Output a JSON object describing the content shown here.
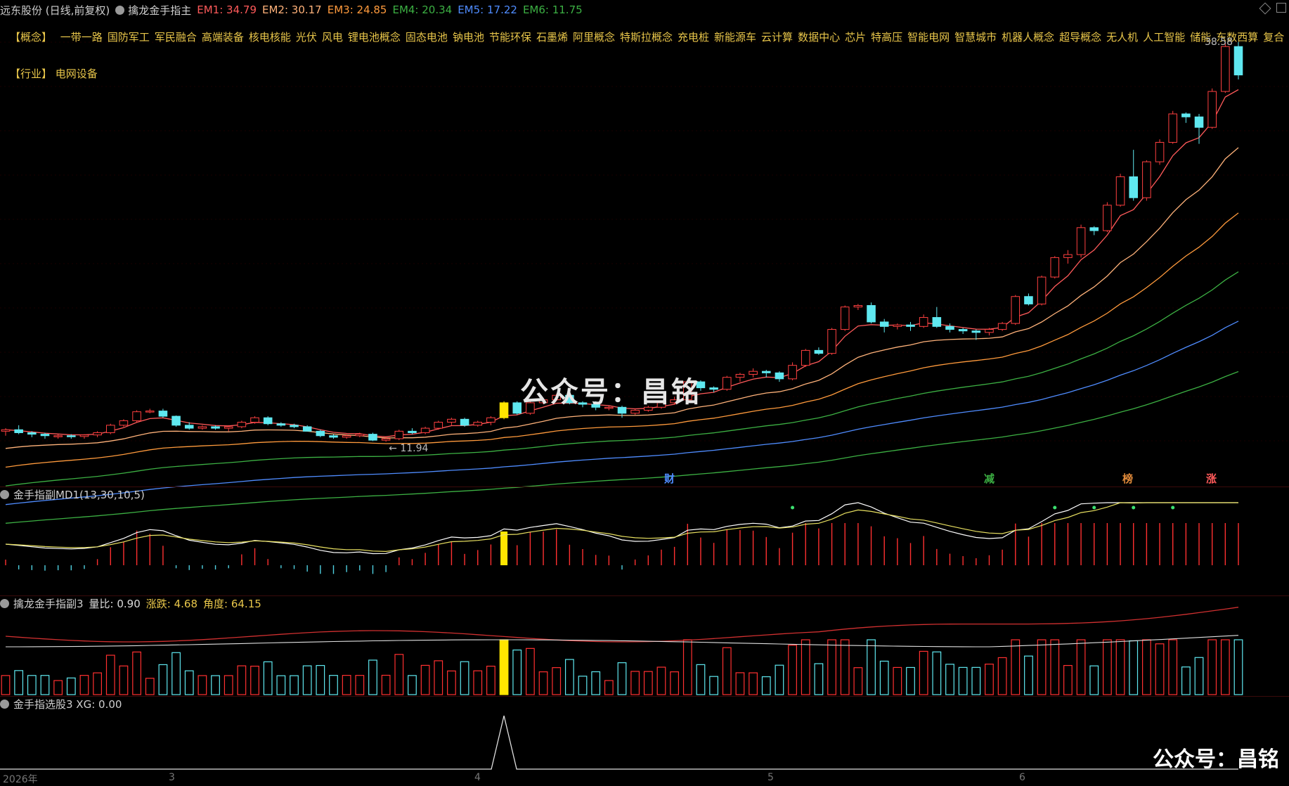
{
  "header": {
    "stock": "远东股份 (日线,前复权)",
    "indicator": "擒龙金手指主",
    "em": [
      {
        "label": "EM1: 34.79",
        "color": "#ff5a5a"
      },
      {
        "label": "EM2: 30.17",
        "color": "#ffb27a"
      },
      {
        "label": "EM3: 24.85",
        "color": "#ff9a3c"
      },
      {
        "label": "EM4: 20.34",
        "color": "#3cb043"
      },
      {
        "label": "EM5: 17.22",
        "color": "#4f8cff"
      },
      {
        "label": "EM6: 11.75",
        "color": "#3cb043"
      }
    ]
  },
  "concepts": {
    "label": "【概念】",
    "items": [
      "一带一路",
      "国防军工",
      "军民融合",
      "高端装备",
      "核电核能",
      "光伏",
      "风电",
      "锂电池概念",
      "固态电池",
      "钠电池",
      "节能环保",
      "石墨烯",
      "阿里概念",
      "特斯拉概念",
      "充电桩",
      "新能源车",
      "云计算",
      "数据中心",
      "芯片",
      "特高压",
      "智能电网",
      "智慧城市",
      "机器人概念",
      "超导概念",
      "无人机",
      "人工智能",
      "储能",
      "东数西算",
      "复合"
    ]
  },
  "industry": {
    "label": "【行业】",
    "value": "电网设备"
  },
  "annotations": {
    "high": "38.58",
    "low": "11.94"
  },
  "events": [
    {
      "label": "财",
      "color": "#4f8cff"
    },
    {
      "label": "减",
      "color": "#3cb043"
    },
    {
      "label": "榜",
      "color": "#e08a3a"
    },
    {
      "label": "涨",
      "color": "#ff5a5a"
    }
  ],
  "panes": {
    "md1": "金手指副MD1(13,30,10,5)",
    "vol": {
      "name": "擒龙金手指副3",
      "ratio": "量比: 0.90",
      "change": "涨跌: 4.68",
      "angle": "角度: 64.15"
    },
    "xg": "金手指选股3 XG: 0.00"
  },
  "watermark": "公众号：昌铭",
  "xaxis": [
    "2026年",
    "3",
    "4",
    "5",
    "6"
  ],
  "chart_data": {
    "type": "candlestick",
    "ylim": [
      9,
      40
    ],
    "candles": [
      [
        12.6,
        12.8,
        12.3,
        12.7
      ],
      [
        12.7,
        13.0,
        12.4,
        12.5
      ],
      [
        12.5,
        12.6,
        12.2,
        12.4
      ],
      [
        12.4,
        12.5,
        12.1,
        12.3
      ],
      [
        12.3,
        12.4,
        12.1,
        12.3
      ],
      [
        12.3,
        12.4,
        12.1,
        12.25
      ],
      [
        12.25,
        12.4,
        12.1,
        12.35
      ],
      [
        12.35,
        12.6,
        12.2,
        12.5
      ],
      [
        12.5,
        13.1,
        12.4,
        13.0
      ],
      [
        13.0,
        13.4,
        12.9,
        13.3
      ],
      [
        13.3,
        14.0,
        13.2,
        13.9
      ],
      [
        13.9,
        14.1,
        13.8,
        13.95
      ],
      [
        13.95,
        14.1,
        13.5,
        13.6
      ],
      [
        13.6,
        13.65,
        12.9,
        13.0
      ],
      [
        13.0,
        13.2,
        12.7,
        12.8
      ],
      [
        12.8,
        13.0,
        12.7,
        12.9
      ],
      [
        12.9,
        13.0,
        12.7,
        12.8
      ],
      [
        12.8,
        13.0,
        12.6,
        12.9
      ],
      [
        12.9,
        13.3,
        12.8,
        13.2
      ],
      [
        13.2,
        13.6,
        13.1,
        13.5
      ],
      [
        13.5,
        13.6,
        13.0,
        13.1
      ],
      [
        13.1,
        13.2,
        12.9,
        13.0
      ],
      [
        13.0,
        13.1,
        12.8,
        12.9
      ],
      [
        12.9,
        13.0,
        12.6,
        12.6
      ],
      [
        12.6,
        12.7,
        12.2,
        12.3
      ],
      [
        12.3,
        12.4,
        12.1,
        12.2
      ],
      [
        12.2,
        12.4,
        12.1,
        12.3
      ],
      [
        12.3,
        12.5,
        12.2,
        12.4
      ],
      [
        12.4,
        12.5,
        11.94,
        12.0
      ],
      [
        12.0,
        12.2,
        11.9,
        12.1
      ],
      [
        12.1,
        12.7,
        12.0,
        12.6
      ],
      [
        12.6,
        12.8,
        12.4,
        12.5
      ],
      [
        12.5,
        12.9,
        12.4,
        12.8
      ],
      [
        12.8,
        13.3,
        12.7,
        13.2
      ],
      [
        13.2,
        13.5,
        13.0,
        13.4
      ],
      [
        13.4,
        13.5,
        12.9,
        13.0
      ],
      [
        13.0,
        13.3,
        12.9,
        13.2
      ],
      [
        13.2,
        13.6,
        13.0,
        13.5
      ],
      [
        13.5,
        14.6,
        13.4,
        14.5
      ],
      [
        14.5,
        14.6,
        13.7,
        13.8
      ],
      [
        13.8,
        14.6,
        13.7,
        14.5
      ],
      [
        14.5,
        14.8,
        14.4,
        14.7
      ],
      [
        14.7,
        15.1,
        14.6,
        15.0
      ],
      [
        15.0,
        15.1,
        14.4,
        14.5
      ],
      [
        14.5,
        14.6,
        14.2,
        14.4
      ],
      [
        14.4,
        14.6,
        14.0,
        14.2
      ],
      [
        14.2,
        14.3,
        14.0,
        14.2
      ],
      [
        14.2,
        14.3,
        13.5,
        13.8
      ],
      [
        13.8,
        14.1,
        13.7,
        14.0
      ],
      [
        14.0,
        14.3,
        13.9,
        14.2
      ],
      [
        14.2,
        14.6,
        14.1,
        14.5
      ],
      [
        14.5,
        14.9,
        14.4,
        14.7
      ],
      [
        14.7,
        16.0,
        14.6,
        15.9
      ],
      [
        15.9,
        16.0,
        15.3,
        15.5
      ],
      [
        15.5,
        15.6,
        15.2,
        15.4
      ],
      [
        15.4,
        16.3,
        15.3,
        16.2
      ],
      [
        16.2,
        16.5,
        15.9,
        16.4
      ],
      [
        16.4,
        16.8,
        16.2,
        16.6
      ],
      [
        16.6,
        16.7,
        16.2,
        16.5
      ],
      [
        16.5,
        16.6,
        15.9,
        16.1
      ],
      [
        16.1,
        17.2,
        16.0,
        17.0
      ],
      [
        17.0,
        18.1,
        16.9,
        18.0
      ],
      [
        18.0,
        18.2,
        17.7,
        17.8
      ],
      [
        17.8,
        19.5,
        17.7,
        19.4
      ],
      [
        19.4,
        21.0,
        19.3,
        20.9
      ],
      [
        20.9,
        21.1,
        20.7,
        21.0
      ],
      [
        21.0,
        21.2,
        19.8,
        19.9
      ],
      [
        19.9,
        20.1,
        19.2,
        19.6
      ],
      [
        19.6,
        19.8,
        19.4,
        19.7
      ],
      [
        19.7,
        19.9,
        19.3,
        19.6
      ],
      [
        19.6,
        20.4,
        19.5,
        20.2
      ],
      [
        20.2,
        20.9,
        19.5,
        19.6
      ],
      [
        19.6,
        19.8,
        19.2,
        19.4
      ],
      [
        19.4,
        19.5,
        19.1,
        19.3
      ],
      [
        19.3,
        19.4,
        18.7,
        19.2
      ],
      [
        19.2,
        19.5,
        19.0,
        19.4
      ],
      [
        19.4,
        19.9,
        19.3,
        19.8
      ],
      [
        19.8,
        21.7,
        19.7,
        21.6
      ],
      [
        21.6,
        21.8,
        21.0,
        21.1
      ],
      [
        21.1,
        23.0,
        21.0,
        22.9
      ],
      [
        22.9,
        24.3,
        22.8,
        24.2
      ],
      [
        24.2,
        24.7,
        23.8,
        24.4
      ],
      [
        24.4,
        26.4,
        24.2,
        26.2
      ],
      [
        26.2,
        26.3,
        25.7,
        26.0
      ],
      [
        26.0,
        27.9,
        25.9,
        27.7
      ],
      [
        27.7,
        29.8,
        27.6,
        29.6
      ],
      [
        29.6,
        31.4,
        28.0,
        28.2
      ],
      [
        28.2,
        30.7,
        28.0,
        30.6
      ],
      [
        30.6,
        32.1,
        30.4,
        31.9
      ],
      [
        31.9,
        34.0,
        31.8,
        33.8
      ],
      [
        33.8,
        33.9,
        33.2,
        33.6
      ],
      [
        33.6,
        33.8,
        31.8,
        32.9
      ],
      [
        32.9,
        35.5,
        32.8,
        35.3
      ],
      [
        35.3,
        38.58,
        35.2,
        38.3
      ],
      [
        38.3,
        38.6,
        36.1,
        36.4
      ]
    ],
    "xg_spike_index": 38
  }
}
